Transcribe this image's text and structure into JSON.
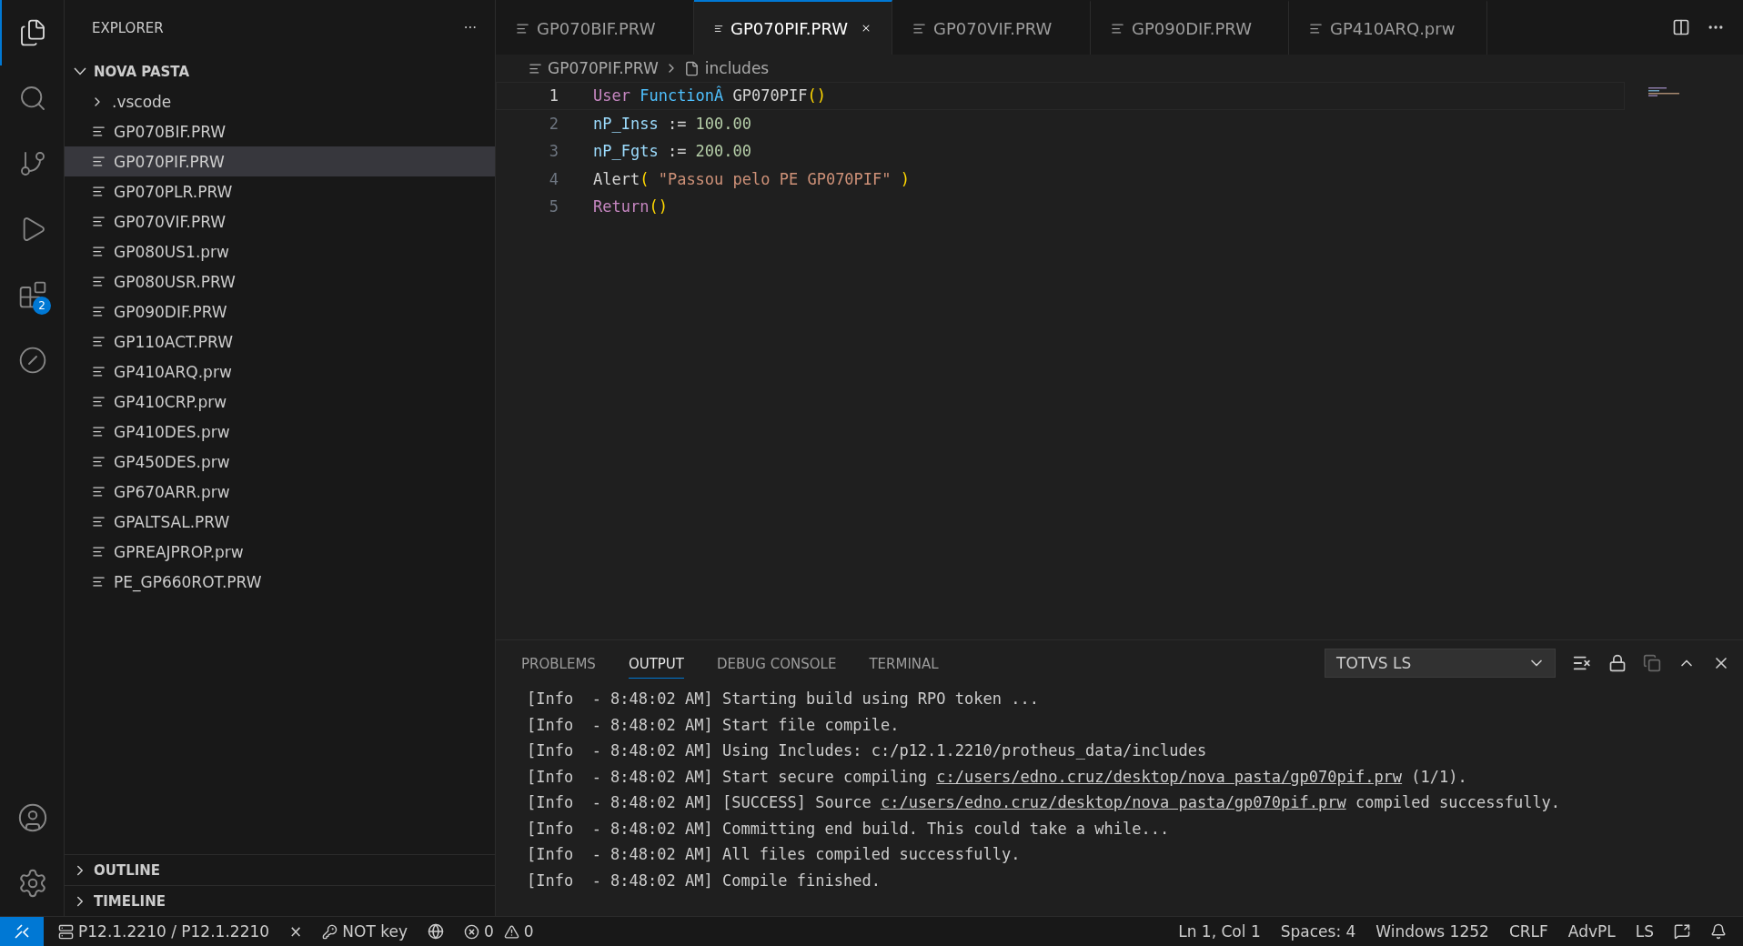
{
  "activity_bar": {
    "items": [
      {
        "kind": "files",
        "selected": true
      },
      {
        "kind": "search",
        "selected": false
      },
      {
        "kind": "source-control",
        "selected": false
      },
      {
        "kind": "run-debug",
        "selected": false
      },
      {
        "kind": "extensions",
        "selected": false,
        "badge": "2"
      },
      {
        "kind": "totvs",
        "selected": false
      }
    ],
    "bottom": [
      {
        "kind": "account"
      },
      {
        "kind": "settings"
      }
    ]
  },
  "sidebar": {
    "title": "EXPLORER",
    "more": "···",
    "folder": {
      "label": "NOVA PASTA",
      "expanded": true,
      "children": [
        {
          "label": ".vscode",
          "kind": "folder",
          "expanded": false,
          "selected": false
        },
        {
          "label": "GP070BIF.PRW",
          "kind": "file",
          "selected": false
        },
        {
          "label": "GP070PIF.PRW",
          "kind": "file",
          "selected": true
        },
        {
          "label": "GP070PLR.PRW",
          "kind": "file",
          "selected": false
        },
        {
          "label": "GP070VIF.PRW",
          "kind": "file",
          "selected": false
        },
        {
          "label": "GP080US1.prw",
          "kind": "file",
          "selected": false
        },
        {
          "label": "GP080USR.PRW",
          "kind": "file",
          "selected": false
        },
        {
          "label": "GP090DIF.PRW",
          "kind": "file",
          "selected": false
        },
        {
          "label": "GP110ACT.PRW",
          "kind": "file",
          "selected": false
        },
        {
          "label": "GP410ARQ.prw",
          "kind": "file",
          "selected": false
        },
        {
          "label": "GP410CRP.prw",
          "kind": "file",
          "selected": false
        },
        {
          "label": "GP410DES.prw",
          "kind": "file",
          "selected": false
        },
        {
          "label": "GP450DES.prw",
          "kind": "file",
          "selected": false
        },
        {
          "label": "GP670ARR.prw",
          "kind": "file",
          "selected": false
        },
        {
          "label": "GPALTSAL.PRW",
          "kind": "file",
          "selected": false
        },
        {
          "label": "GPREAJPROP.prw",
          "kind": "file",
          "selected": false
        },
        {
          "label": "PE_GP660ROT.PRW",
          "kind": "file",
          "selected": false
        }
      ]
    },
    "sections": [
      {
        "label": "OUTLINE",
        "expanded": false
      },
      {
        "label": "TIMELINE",
        "expanded": false
      }
    ]
  },
  "tabs": [
    {
      "label": "GP070BIF.PRW",
      "selected": false
    },
    {
      "label": "GP070PIF.PRW",
      "selected": true
    },
    {
      "label": "GP070VIF.PRW",
      "selected": false
    },
    {
      "label": "GP090DIF.PRW",
      "selected": false
    },
    {
      "label": "GP410ARQ.prw",
      "selected": false
    }
  ],
  "breadcrumb": [
    {
      "label": "GP070PIF.PRW",
      "kind": "file"
    },
    {
      "label": "includes",
      "kind": "page"
    }
  ],
  "code": [
    {
      "number": "1",
      "current": true,
      "tokens": [
        {
          "text": "User",
          "kind": "keyword"
        },
        {
          "text": " FunctionÂ",
          "kind": "function"
        },
        {
          "text": " GP070PIF",
          "kind": "plain"
        },
        {
          "text": "()",
          "kind": "bracket"
        }
      ]
    },
    {
      "number": "2",
      "current": false,
      "tokens": [
        {
          "text": "nP_Inss",
          "kind": "variable"
        },
        {
          "text": " := ",
          "kind": "plain"
        },
        {
          "text": "100.00",
          "kind": "number"
        }
      ]
    },
    {
      "number": "3",
      "current": false,
      "tokens": [
        {
          "text": "nP_Fgts",
          "kind": "variable"
        },
        {
          "text": " := ",
          "kind": "plain"
        },
        {
          "text": "200.00",
          "kind": "number"
        }
      ]
    },
    {
      "number": "4",
      "current": false,
      "tokens": [
        {
          "text": "Alert",
          "kind": "plain"
        },
        {
          "text": "( ",
          "kind": "bracket"
        },
        {
          "text": "\"Passou pelo PE GP070PIF\"",
          "kind": "string"
        },
        {
          "text": " )",
          "kind": "bracket"
        }
      ]
    },
    {
      "number": "5",
      "current": false,
      "tokens": [
        {
          "text": "Return",
          "kind": "keyword"
        },
        {
          "text": "()",
          "kind": "bracket"
        }
      ]
    }
  ],
  "panel": {
    "tabs": [
      {
        "label": "PROBLEMS",
        "selected": false
      },
      {
        "label": "OUTPUT",
        "selected": true
      },
      {
        "label": "DEBUG CONSOLE",
        "selected": false
      },
      {
        "label": "TERMINAL",
        "selected": false
      }
    ],
    "channel": "TOTVS LS",
    "lines": [
      [
        {
          "text": "[Info  - 8:48:02 AM] Starting build using RPO token ...",
          "kind": "plain"
        }
      ],
      [
        {
          "text": "[Info  - 8:48:02 AM] Start file compile.",
          "kind": "plain"
        }
      ],
      [
        {
          "text": "[Info  - 8:48:02 AM] Using Includes: c:/p12.1.2210/protheus_data/includes",
          "kind": "plain"
        }
      ],
      [
        {
          "text": "[Info  - 8:48:02 AM] Start secure compiling ",
          "kind": "plain"
        },
        {
          "text": "c:/users/edno.cruz/desktop/nova pasta/gp070pif.prw",
          "kind": "link"
        },
        {
          "text": " (1/1).",
          "kind": "plain"
        }
      ],
      [
        {
          "text": "[Info  - 8:48:02 AM] [SUCCESS] Source ",
          "kind": "plain"
        },
        {
          "text": "c:/users/edno.cruz/desktop/nova pasta/gp070pif.prw",
          "kind": "link"
        },
        {
          "text": " compiled successfully.",
          "kind": "plain"
        }
      ],
      [
        {
          "text": "[Info  - 8:48:02 AM] Committing end build. This could take a while...",
          "kind": "plain"
        }
      ],
      [
        {
          "text": "[Info  - 8:48:02 AM] All files compiled successfully.",
          "kind": "plain"
        }
      ],
      [
        {
          "text": "[Info  - 8:48:02 AM] Compile finished.",
          "kind": "plain"
        }
      ]
    ]
  },
  "status_bar": {
    "left": [
      {
        "text": "P12.1.2210 / P12.1.2210",
        "kind": "server"
      },
      {
        "text": "×",
        "kind": "plain"
      },
      {
        "text": "NOT key",
        "kind": "key"
      },
      {
        "kind": "globe"
      },
      {
        "text": "0",
        "kind": "errors"
      },
      {
        "text": "0",
        "kind": "warnings"
      }
    ],
    "right": [
      {
        "text": "Ln 1, Col 1",
        "kind": "plain"
      },
      {
        "text": "Spaces: 4",
        "kind": "plain"
      },
      {
        "text": "Windows 1252",
        "kind": "plain"
      },
      {
        "text": "CRLF",
        "kind": "plain"
      },
      {
        "text": "AdvPL",
        "kind": "plain"
      },
      {
        "text": "LS",
        "kind": "plain"
      },
      {
        "kind": "feedback"
      },
      {
        "kind": "bell"
      }
    ]
  }
}
